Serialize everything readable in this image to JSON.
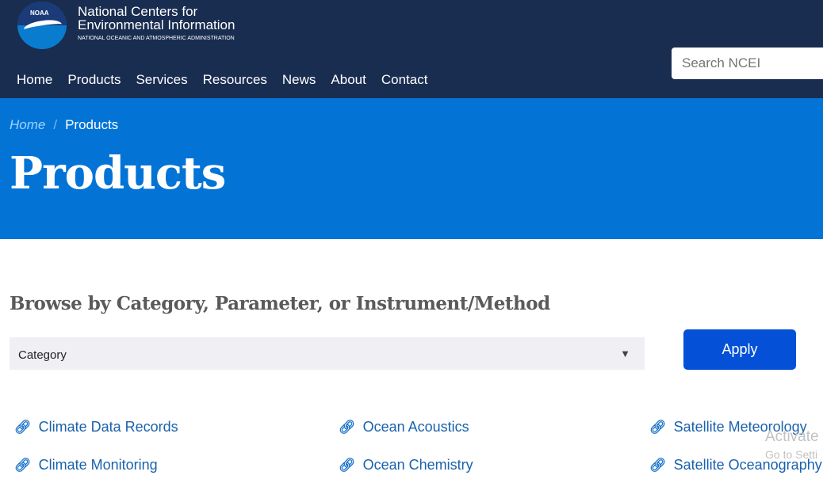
{
  "header": {
    "logo_text": "NOAA",
    "title_line1": "National Centers for",
    "title_line2": "Environmental Information",
    "subtitle": "NATIONAL OCEANIC AND ATMOSPHERIC ADMINISTRATION",
    "search_placeholder": "Search NCEI",
    "nav": [
      "Home",
      "Products",
      "Services",
      "Resources",
      "News",
      "About",
      "Contact"
    ]
  },
  "breadcrumb": {
    "home": "Home",
    "current": "Products"
  },
  "page_title": "Products",
  "browse": {
    "heading": "Browse by Category, Parameter, or Instrument/Method",
    "select_value": "Category",
    "apply": "Apply"
  },
  "links": [
    "Climate Data Records",
    "Ocean Acoustics",
    "Satellite Meteorology",
    "Climate Monitoring",
    "Ocean Chemistry",
    "Satellite Oceanography"
  ],
  "watermark": {
    "line1": "Activate",
    "line2": "Go to Setti"
  },
  "colors": {
    "header": "#192d50",
    "hero": "#0374d6",
    "apply": "#0451d8",
    "link": "#1a62ad"
  }
}
